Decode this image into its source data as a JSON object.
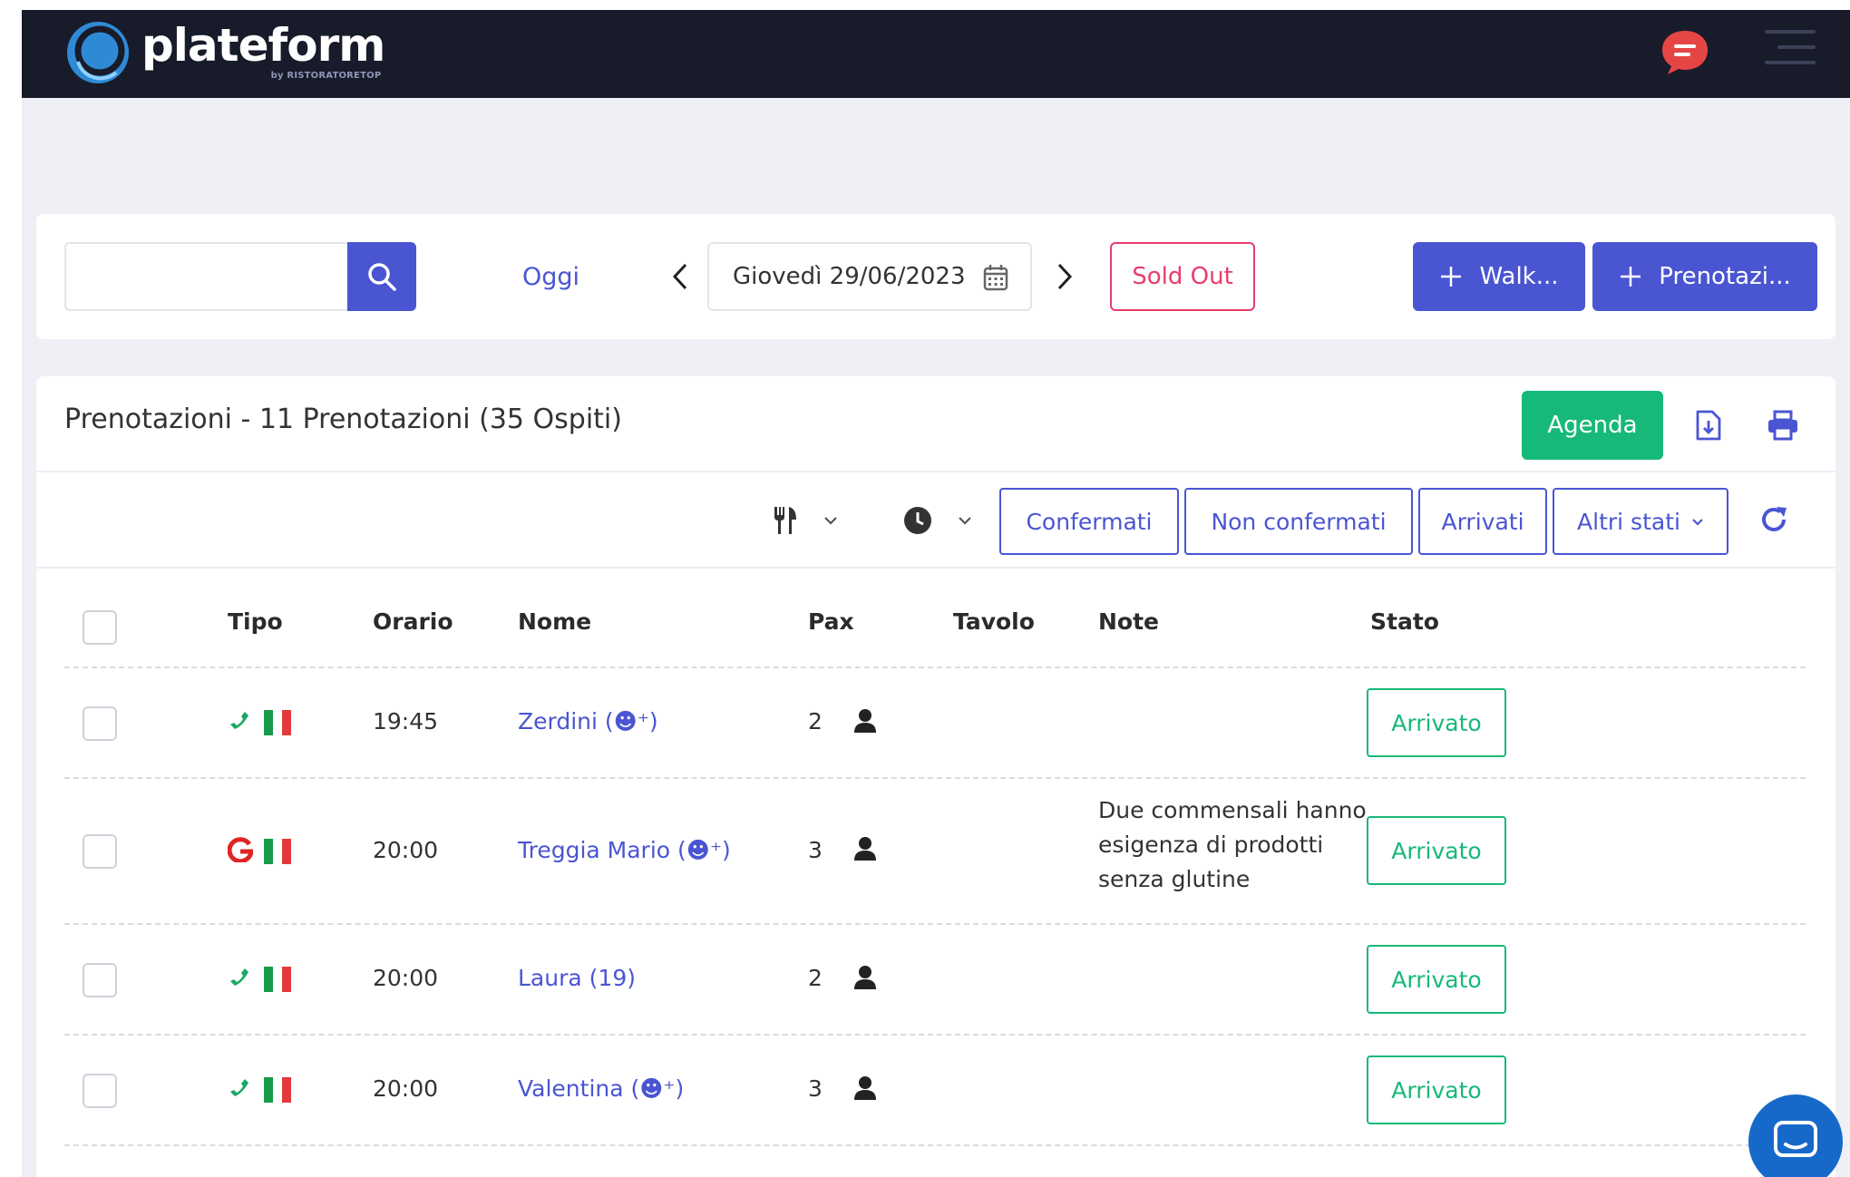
{
  "brand": {
    "name": "plateform",
    "tagline": "by RISTORATORETOP",
    "colors": {
      "nav": "#181b29",
      "primary": "#4a55d2",
      "success": "#17b978",
      "danger": "#e83d6c",
      "chat": "#e64545"
    }
  },
  "toolbar": {
    "search_placeholder": "",
    "search_icon": "search-icon",
    "today_label": "Oggi",
    "date_value": "Giovedì 29/06/2023",
    "sold_out_label": "Sold Out",
    "walk_in_label": "Walk...",
    "new_booking_label": "Prenotazi..."
  },
  "list": {
    "title": "Prenotazioni - 11 Prenotazioni (35 Ospiti)",
    "agenda_label": "Agenda",
    "filters": {
      "confirmed": "Confermati",
      "unconfirmed": "Non confermati",
      "arrived": "Arrivati",
      "other": "Altri stati"
    }
  },
  "table": {
    "columns": [
      "Tipo",
      "Orario",
      "Nome",
      "Pax",
      "Tavolo",
      "Note",
      "Stato"
    ],
    "rows": [
      {
        "source": "phone",
        "time": "19:45",
        "name": "Zerdini",
        "badge": "(☻⁺)",
        "pax": "2",
        "table": "",
        "note": "",
        "status": "Arrivato"
      },
      {
        "source": "google",
        "time": "20:00",
        "name": "Treggia Mario",
        "badge": "(☻⁺)",
        "pax": "3",
        "table": "",
        "note": "Due commensali hanno esigenza di prodotti senza glutine",
        "status": "Arrivato"
      },
      {
        "source": "phone",
        "time": "20:00",
        "name": "Laura",
        "badge": "(19)",
        "pax": "2",
        "table": "",
        "note": "",
        "status": "Arrivato"
      },
      {
        "source": "phone",
        "time": "20:00",
        "name": "Valentina",
        "badge": "(☻⁺)",
        "pax": "3",
        "table": "",
        "note": "",
        "status": "Arrivato"
      }
    ]
  }
}
